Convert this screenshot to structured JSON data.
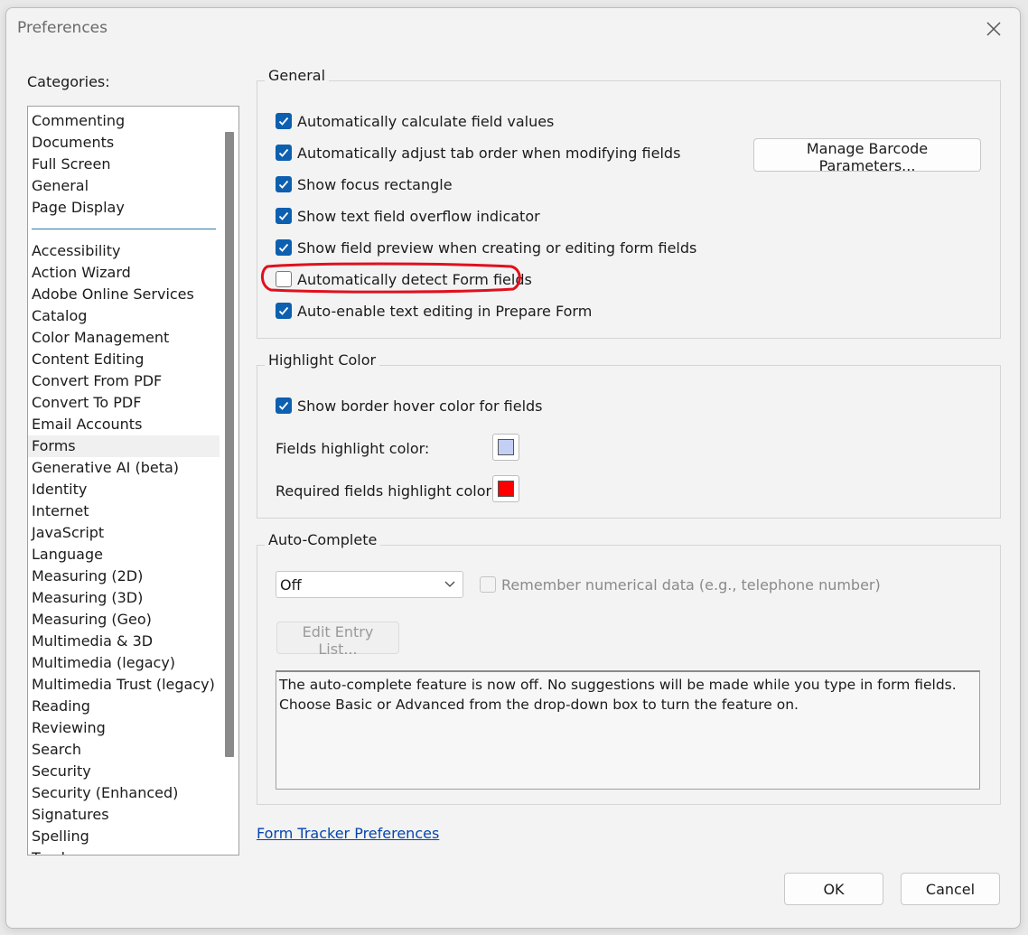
{
  "window": {
    "title": "Preferences"
  },
  "categories": {
    "label": "Categories:",
    "top_items": [
      "Commenting",
      "Documents",
      "Full Screen",
      "General",
      "Page Display"
    ],
    "items": [
      "Accessibility",
      "Action Wizard",
      "Adobe Online Services",
      "Catalog",
      "Color Management",
      "Content Editing",
      "Convert From PDF",
      "Convert To PDF",
      "Email Accounts",
      "Forms",
      "Generative AI (beta)",
      "Identity",
      "Internet",
      "JavaScript",
      "Language",
      "Measuring (2D)",
      "Measuring (3D)",
      "Measuring (Geo)",
      "Multimedia & 3D",
      "Multimedia (legacy)",
      "Multimedia Trust (legacy)",
      "Reading",
      "Reviewing",
      "Search",
      "Security",
      "Security (Enhanced)",
      "Signatures",
      "Spelling",
      "Tracker"
    ],
    "selected": "Forms"
  },
  "general": {
    "legend": "General",
    "options": [
      {
        "label": "Automatically calculate field values",
        "checked": true
      },
      {
        "label": "Automatically adjust tab order when modifying fields",
        "checked": true
      },
      {
        "label": "Show focus rectangle",
        "checked": true
      },
      {
        "label": "Show text field overflow indicator",
        "checked": true
      },
      {
        "label": "Show field preview when creating or editing form fields",
        "checked": true
      },
      {
        "label": "Automatically detect Form fields",
        "checked": false
      },
      {
        "label": "Auto-enable text editing in Prepare Form",
        "checked": true
      }
    ],
    "manage_barcode_button": "Manage Barcode Parameters..."
  },
  "highlight": {
    "legend": "Highlight Color",
    "show_border_label": "Show border hover color for fields",
    "show_border_checked": true,
    "fields_label": "Fields highlight color:",
    "fields_color": "#c3cff5",
    "required_label": "Required fields highlight color:",
    "required_color": "#ff0000"
  },
  "autocomplete": {
    "legend": "Auto-Complete",
    "select_value": "Off",
    "remember_label": "Remember numerical data (e.g., telephone number)",
    "edit_entry_button": "Edit Entry List...",
    "description": "The auto-complete feature is now off. No suggestions will be made while you type in form fields. Choose Basic or Advanced from the drop-down box to turn the feature on."
  },
  "form_tracker_link": "Form Tracker Preferences",
  "buttons": {
    "ok": "OK",
    "cancel": "Cancel"
  },
  "colors": {
    "accent": "#0d5fb0",
    "annotation": "#e0101e"
  }
}
